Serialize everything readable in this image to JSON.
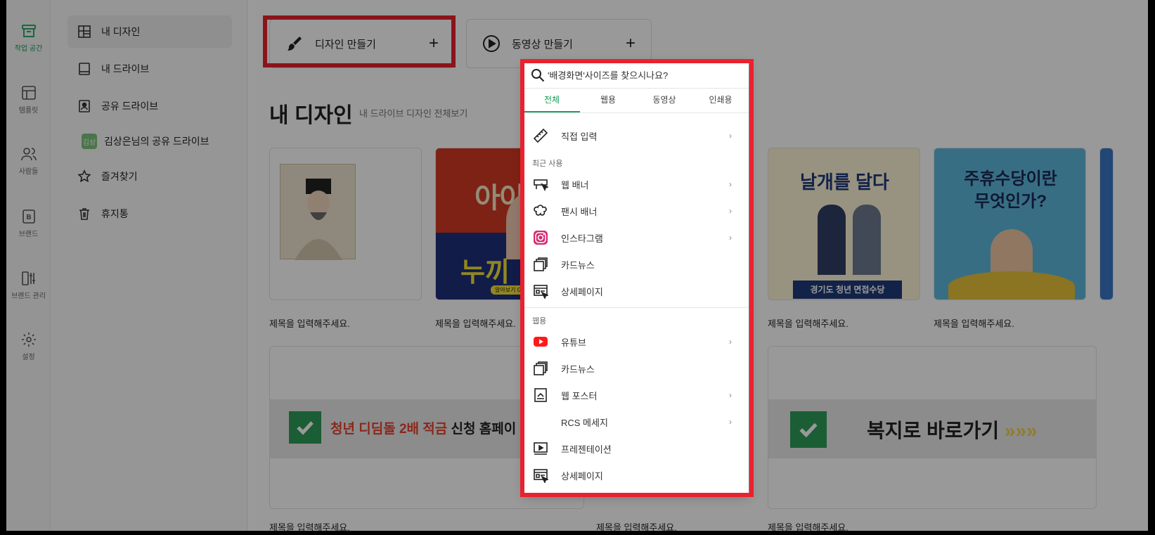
{
  "rail": [
    {
      "label": "작업 공간",
      "icon": "archive-icon",
      "active": true
    },
    {
      "label": "템플릿",
      "icon": "template-icon"
    },
    {
      "label": "사람들",
      "icon": "people-icon"
    },
    {
      "label": "브랜드",
      "icon": "brand-icon"
    },
    {
      "label": "브랜드 관리",
      "icon": "brand-manage-icon"
    },
    {
      "label": "설정",
      "icon": "gear-icon"
    }
  ],
  "sidebar": {
    "items": [
      {
        "label": "내 디자인",
        "icon": "grid-icon"
      },
      {
        "label": "내 드라이브",
        "icon": "drive-icon"
      },
      {
        "label": "공유 드라이브",
        "icon": "shared-drive-icon"
      },
      {
        "label": "즐겨찾기",
        "icon": "star-icon"
      },
      {
        "label": "휴지통",
        "icon": "trash-icon"
      }
    ],
    "shared_sub": {
      "badge": "김상",
      "label": "김상은님의 공유 드라이브"
    }
  },
  "create": {
    "design_label": "디자인 만들기",
    "video_label": "동영상 만들기",
    "plus": "+"
  },
  "section": {
    "title": "내 디자인",
    "link": "내 드라이브 디자인 전체보기"
  },
  "cards": {
    "caption": "제목을 입력해주세요.",
    "texts": {
      "c2_top": "아이",
      "c2_bottom": "누끼",
      "c2_small": "알아보기 Go",
      "c4_title": "날개를 달다",
      "c4_bar": "경기도 청년 면접수당",
      "c5_line1": "주휴수당이란",
      "c5_line2": "무엇인가?",
      "b1_red": "청년 디딤돌 2배 적금",
      "b1_black": "신청 홈페이",
      "b2": "복지로 바로가기",
      "arrows": "»»»"
    }
  },
  "popup": {
    "search_placeholder": "'배경화면'사이즈를 찾으시나요?",
    "tabs": [
      "전체",
      "웹용",
      "동영상",
      "인쇄용"
    ],
    "direct_input": "직접 입력",
    "recent_label": "최근 사용",
    "recent": [
      {
        "label": "웹 배너",
        "icon": "web-banner-icon",
        "arrow": true
      },
      {
        "label": "팬시 배너",
        "icon": "fancy-banner-icon",
        "arrow": true
      },
      {
        "label": "인스타그램",
        "icon": "instagram-icon",
        "arrow": true
      },
      {
        "label": "카드뉴스",
        "icon": "card-news-icon",
        "arrow": false
      },
      {
        "label": "상세페이지",
        "icon": "detail-page-icon",
        "arrow": false
      }
    ],
    "web_label": "웹용",
    "web": [
      {
        "label": "유튜브",
        "icon": "youtube-icon",
        "arrow": true
      },
      {
        "label": "카드뉴스",
        "icon": "card-news-icon",
        "arrow": false
      },
      {
        "label": "웹 포스터",
        "icon": "web-poster-icon",
        "arrow": true
      },
      {
        "label": "RCS 메세지",
        "icon": "",
        "arrow": true
      },
      {
        "label": "프레젠테이션",
        "icon": "presentation-icon",
        "arrow": false
      },
      {
        "label": "상세페이지",
        "icon": "detail-page-icon",
        "arrow": false
      }
    ],
    "chevron": "›"
  },
  "colors": {
    "accent": "#19a05a",
    "highlight": "#e8222e"
  }
}
